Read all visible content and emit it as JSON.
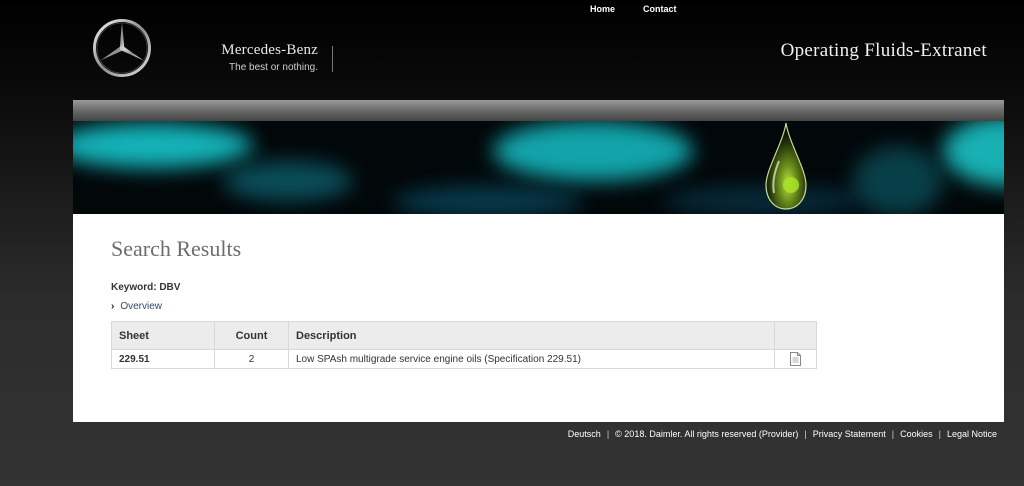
{
  "nav": {
    "home": "Home",
    "contact": "Contact"
  },
  "brand": {
    "name": "Mercedes-Benz",
    "tagline": "The best or nothing.",
    "logo_icon": "mercedes-star-icon"
  },
  "site_title": "Operating Fluids-Extranet",
  "page": {
    "title": "Search Results",
    "keyword_label": "Keyword: DBV",
    "overview_link": "Overview"
  },
  "table": {
    "headers": {
      "sheet": "Sheet",
      "count": "Count",
      "description": "Description"
    },
    "rows": [
      {
        "sheet": "229.51",
        "count": "2",
        "description": "Low SPAsh multigrade service engine oils (Specification 229.51)",
        "icon": "document-icon"
      }
    ]
  },
  "footer": {
    "deutsch": "Deutsch",
    "copyright": "© 2018. Daimler. All rights reserved (Provider)",
    "privacy": "Privacy Statement",
    "cookies": "Cookies",
    "legal": "Legal Notice"
  },
  "colors": {
    "accent_teal": "#16c6cc",
    "link": "#2b4a6f",
    "table_header_bg": "#ececec"
  }
}
